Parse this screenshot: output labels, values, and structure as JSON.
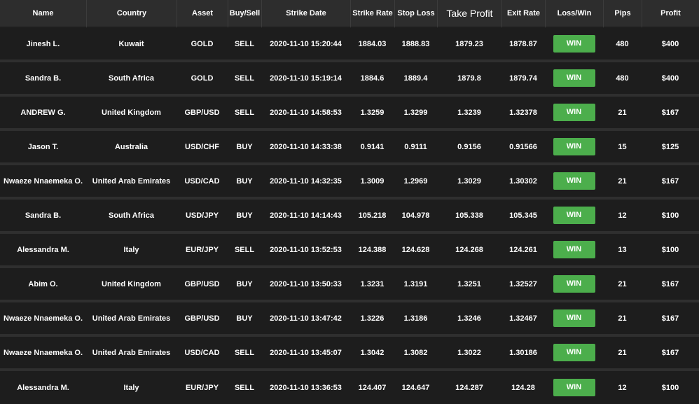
{
  "columns": [
    "Name",
    "Country",
    "Asset",
    "Buy/Sell",
    "Strike Date",
    "Strike Rate",
    "Stop Loss",
    "Take Profit",
    "Exit Rate",
    "Loss/Win",
    "Pips",
    "Profit"
  ],
  "colors": {
    "header_bg": "#2d2d2d",
    "row_bg": "#1d1d1d",
    "row_separator": "#2f2f2f",
    "win_green": "#4cae4c"
  },
  "rows": [
    {
      "name": "Jinesh L.",
      "country": "Kuwait",
      "asset": "GOLD",
      "side": "SELL",
      "strike_date": "2020-11-10 15:20:44",
      "strike_rate": "1884.03",
      "stop_loss": "1888.83",
      "take_profit": "1879.23",
      "exit_rate": "1878.87",
      "result": "WIN",
      "pips": "480",
      "profit": "$400"
    },
    {
      "name": "Sandra B.",
      "country": "South Africa",
      "asset": "GOLD",
      "side": "SELL",
      "strike_date": "2020-11-10 15:19:14",
      "strike_rate": "1884.6",
      "stop_loss": "1889.4",
      "take_profit": "1879.8",
      "exit_rate": "1879.74",
      "result": "WIN",
      "pips": "480",
      "profit": "$400"
    },
    {
      "name": "ANDREW G.",
      "country": "United Kingdom",
      "asset": "GBP/USD",
      "side": "SELL",
      "strike_date": "2020-11-10 14:58:53",
      "strike_rate": "1.3259",
      "stop_loss": "1.3299",
      "take_profit": "1.3239",
      "exit_rate": "1.32378",
      "result": "WIN",
      "pips": "21",
      "profit": "$167"
    },
    {
      "name": "Jason T.",
      "country": "Australia",
      "asset": "USD/CHF",
      "side": "BUY",
      "strike_date": "2020-11-10 14:33:38",
      "strike_rate": "0.9141",
      "stop_loss": "0.9111",
      "take_profit": "0.9156",
      "exit_rate": "0.91566",
      "result": "WIN",
      "pips": "15",
      "profit": "$125"
    },
    {
      "name": "Nwaeze Nnaemeka O.",
      "country": "United Arab Emirates",
      "asset": "USD/CAD",
      "side": "BUY",
      "strike_date": "2020-11-10 14:32:35",
      "strike_rate": "1.3009",
      "stop_loss": "1.2969",
      "take_profit": "1.3029",
      "exit_rate": "1.30302",
      "result": "WIN",
      "pips": "21",
      "profit": "$167"
    },
    {
      "name": "Sandra B.",
      "country": "South Africa",
      "asset": "USD/JPY",
      "side": "BUY",
      "strike_date": "2020-11-10 14:14:43",
      "strike_rate": "105.218",
      "stop_loss": "104.978",
      "take_profit": "105.338",
      "exit_rate": "105.345",
      "result": "WIN",
      "pips": "12",
      "profit": "$100"
    },
    {
      "name": "Alessandra M.",
      "country": "Italy",
      "asset": "EUR/JPY",
      "side": "SELL",
      "strike_date": "2020-11-10 13:52:53",
      "strike_rate": "124.388",
      "stop_loss": "124.628",
      "take_profit": "124.268",
      "exit_rate": "124.261",
      "result": "WIN",
      "pips": "13",
      "profit": "$100"
    },
    {
      "name": "Abim O.",
      "country": "United Kingdom",
      "asset": "GBP/USD",
      "side": "BUY",
      "strike_date": "2020-11-10 13:50:33",
      "strike_rate": "1.3231",
      "stop_loss": "1.3191",
      "take_profit": "1.3251",
      "exit_rate": "1.32527",
      "result": "WIN",
      "pips": "21",
      "profit": "$167"
    },
    {
      "name": "Nwaeze Nnaemeka O.",
      "country": "United Arab Emirates",
      "asset": "GBP/USD",
      "side": "BUY",
      "strike_date": "2020-11-10 13:47:42",
      "strike_rate": "1.3226",
      "stop_loss": "1.3186",
      "take_profit": "1.3246",
      "exit_rate": "1.32467",
      "result": "WIN",
      "pips": "21",
      "profit": "$167"
    },
    {
      "name": "Nwaeze Nnaemeka O.",
      "country": "United Arab Emirates",
      "asset": "USD/CAD",
      "side": "SELL",
      "strike_date": "2020-11-10 13:45:07",
      "strike_rate": "1.3042",
      "stop_loss": "1.3082",
      "take_profit": "1.3022",
      "exit_rate": "1.30186",
      "result": "WIN",
      "pips": "21",
      "profit": "$167"
    },
    {
      "name": "Alessandra M.",
      "country": "Italy",
      "asset": "EUR/JPY",
      "side": "SELL",
      "strike_date": "2020-11-10 13:36:53",
      "strike_rate": "124.407",
      "stop_loss": "124.647",
      "take_profit": "124.287",
      "exit_rate": "124.28",
      "result": "WIN",
      "pips": "12",
      "profit": "$100"
    }
  ]
}
